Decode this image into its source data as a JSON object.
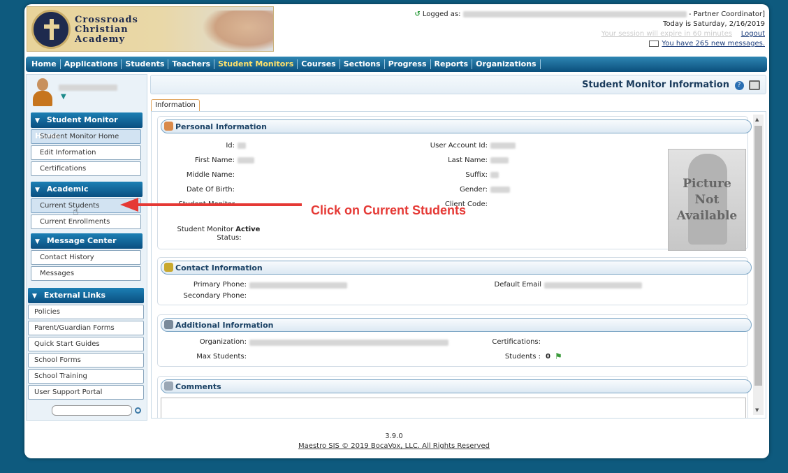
{
  "school": {
    "name_line1": "Crossroads",
    "name_line2": "Christian",
    "name_line3": "Academy"
  },
  "header": {
    "logged_as_prefix": "Logged as:",
    "role": "- Partner Coordinator]",
    "today": "Today is Saturday, 2/16/2019",
    "session": "Your session will expire in 60 minutes",
    "logout": "Logout",
    "messages": "You have 265 new messages."
  },
  "nav": {
    "items": [
      "Home",
      "Applications",
      "Students",
      "Teachers",
      "Student Monitors",
      "Courses",
      "Sections",
      "Progress",
      "Reports",
      "Organizations"
    ],
    "active": "Student Monitors"
  },
  "sidebar": {
    "sections": [
      {
        "title": "Student Monitor Home",
        "items": [
          "Student Monitor Home",
          "Edit Information",
          "Certifications"
        ]
      },
      {
        "title": "Academic",
        "items": [
          "Current Students",
          "Current Enrollments"
        ]
      },
      {
        "title": "Message Center",
        "items": [
          "Contact History",
          "Messages"
        ]
      }
    ],
    "external": {
      "title": "External Links",
      "items": [
        "Policies",
        "Parent/Guardian Forms",
        "Quick Start Guides",
        "School Forms",
        "School Training",
        "User Support Portal"
      ]
    }
  },
  "page": {
    "title": "Student Monitor Information",
    "tab": "Information"
  },
  "personal": {
    "title": "Personal Information",
    "labels": {
      "id": "Id:",
      "user_account": "User Account Id:",
      "first": "First Name:",
      "last": "Last Name:",
      "middle": "Middle Name:",
      "suffix": "Suffix:",
      "dob": "Date Of Birth:",
      "gender": "Gender:",
      "monitor": "Student Monitor",
      "client": "Client Code:",
      "status_l1": "Student Monitor",
      "status_l2": "Status:"
    },
    "status_value": "Active",
    "picture": {
      "l1": "Picture",
      "l2": "Not",
      "l3": "Available"
    }
  },
  "contact": {
    "title": "Contact Information",
    "labels": {
      "primary": "Primary Phone:",
      "secondary": "Secondary Phone:",
      "email": "Default Email"
    }
  },
  "additional": {
    "title": "Additional Information",
    "labels": {
      "org": "Organization:",
      "max": "Max Students:",
      "cert": "Certifications:",
      "students": "Students :"
    },
    "students_value": "0"
  },
  "comments": {
    "title": "Comments"
  },
  "annotation": "Click on Current Students",
  "footer": {
    "version": "3.9.0",
    "copyright": "Maestro SIS © 2019 BocaVox, LLC. All Rights Reserved"
  }
}
